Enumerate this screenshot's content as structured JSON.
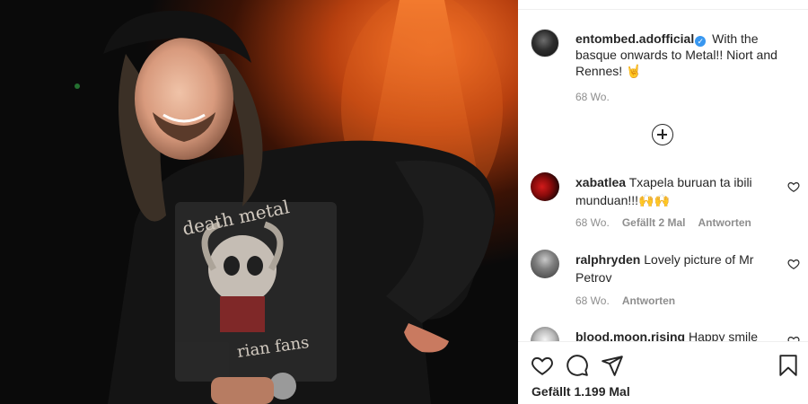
{
  "post": {
    "author": "entombed.adofficial",
    "verified_icon": "verified-badge-icon",
    "caption": "With the basque onwards to Metal!! Niort and Rennes! 🤘",
    "age": "68 Wo.",
    "load_more_icon": "plus-circle-icon"
  },
  "shirt_text": {
    "line1": "death metal",
    "line2": "rian fans"
  },
  "comments": [
    {
      "user": "xabatlea",
      "text": "Txapela buruan ta ibili munduan!!!🙌🙌",
      "age": "68 Wo.",
      "likes": "Gefällt 2 Mal",
      "reply": "Antworten"
    },
    {
      "user": "ralphryden",
      "text": "Lovely picture of Mr Petrov",
      "age": "68 Wo.",
      "reply": "Antworten"
    },
    {
      "user": "blood.moon.rising",
      "text": "Happy smile"
    }
  ],
  "footer": {
    "likes_text": "Gefällt 1.199 Mal",
    "like_icon": "heart-icon",
    "comment_icon": "comment-bubble-icon",
    "share_icon": "paper-plane-icon",
    "save_icon": "bookmark-icon"
  },
  "colors": {
    "accent": "#3897f0",
    "text": "#262626",
    "muted": "#8e8e8e"
  }
}
